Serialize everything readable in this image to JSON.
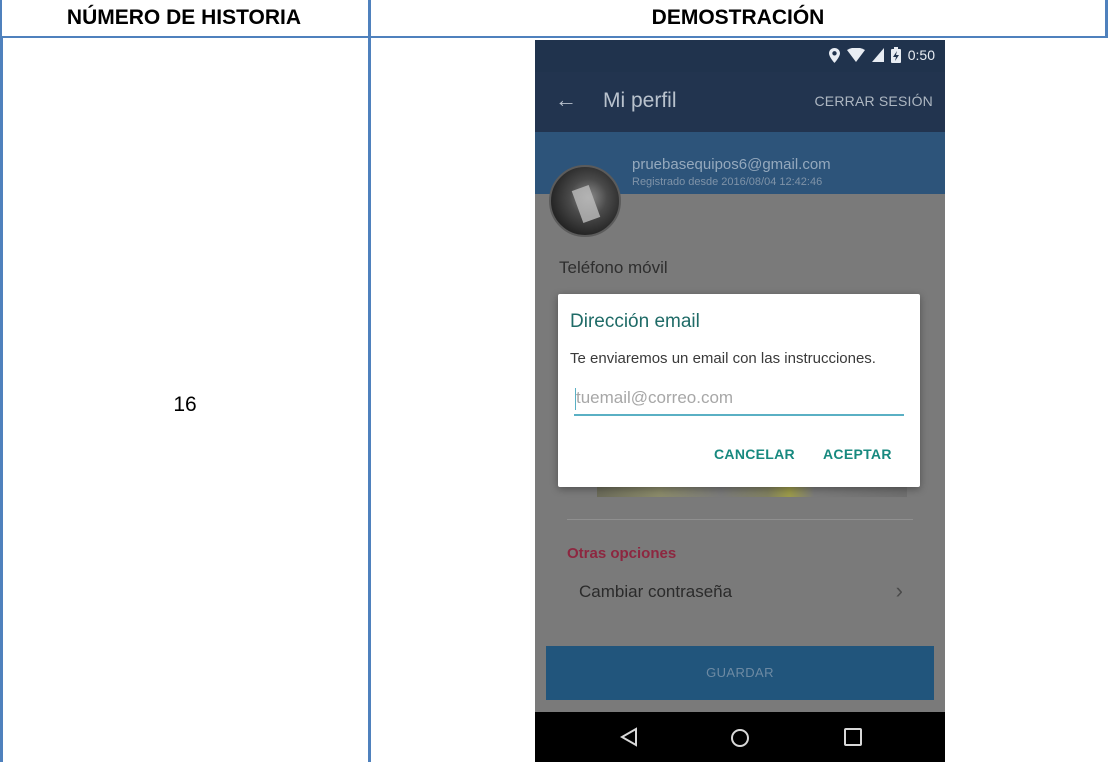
{
  "table": {
    "col1_header": "NÚMERO DE HISTORIA",
    "col2_header": "DEMOSTRACIÓN",
    "story_number": "16"
  },
  "phone": {
    "status_time": "0:50",
    "appbar": {
      "title": "Mi perfil",
      "logout_label": "CERRAR SESIÓN"
    },
    "profile": {
      "email": "pruebasequipos6@gmail.com",
      "registered": "Registrado desde 2016/08/04 12:42:46"
    },
    "phone_label": "Teléfono móvil",
    "dialog": {
      "title": "Dirección email",
      "message": "Te enviaremos un email con las instrucciones.",
      "input_placeholder": "tuemail@correo.com",
      "input_value": "",
      "cancel_label": "CANCELAR",
      "accept_label": "ACEPTAR"
    },
    "other_options": {
      "title": "Otras opciones",
      "change_password": "Cambiar contraseña"
    },
    "save_label": "GUARDAR"
  },
  "colors": {
    "table_border": "#4f81bd",
    "appbar_bg": "#22344f",
    "accent_teal": "#17897f",
    "section_red": "#8d2740"
  },
  "icons": {
    "status": [
      "location-icon",
      "wifi-icon",
      "signal-icon",
      "battery-icon"
    ],
    "back": "back-arrow-icon",
    "chevron": "chevron-right-icon",
    "nav": [
      "nav-back-icon",
      "nav-home-icon",
      "nav-recents-icon"
    ]
  }
}
